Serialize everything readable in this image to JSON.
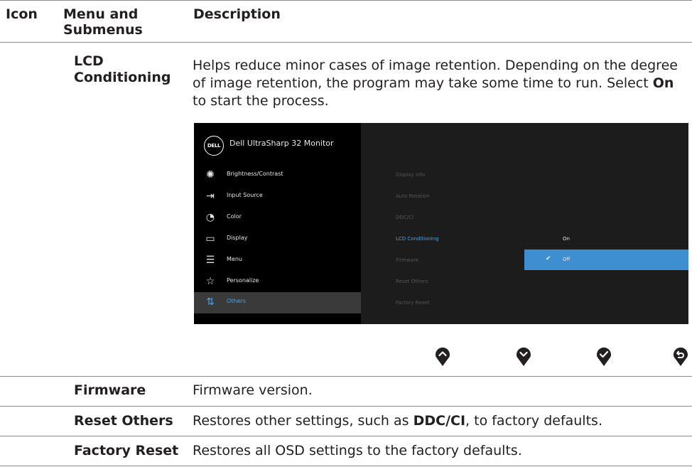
{
  "header": {
    "icon": "Icon",
    "menu": "Menu and Submenus",
    "description": "Description"
  },
  "rows": {
    "lcd": {
      "term": "LCD Conditioning",
      "desc_before": "Helps reduce minor cases of image retention. Depending on the degree of image retention, the program may take some time to run. Select ",
      "desc_bold": "On",
      "desc_after": " to start the process."
    },
    "firmware": {
      "term": "Firmware",
      "desc": "Firmware version."
    },
    "reset_others": {
      "term": "Reset Others",
      "desc_before": "Restores other settings, such as ",
      "desc_bold": "DDC/CI",
      "desc_after": ", to factory defaults."
    },
    "factory_reset": {
      "term": "Factory Reset",
      "desc": "Restores all OSD settings to the factory defaults."
    }
  },
  "osd": {
    "logo": "DELL",
    "title": "Dell UltraSharp 32 Monitor",
    "menu": [
      {
        "label": "Brightness/Contrast",
        "icon": "brightness-icon"
      },
      {
        "label": "Input Source",
        "icon": "input-source-icon"
      },
      {
        "label": "Color",
        "icon": "color-palette-icon"
      },
      {
        "label": "Display",
        "icon": "display-icon"
      },
      {
        "label": "Menu",
        "icon": "menu-icon"
      },
      {
        "label": "Personalize",
        "icon": "star-icon"
      },
      {
        "label": "Others",
        "icon": "others-icon"
      }
    ],
    "active_menu": "Others",
    "submenu": [
      "Display Info",
      "Auto Rotation",
      "DDC/CI",
      "LCD Conditioning",
      "Firmware",
      "Reset Others",
      "Factory Reset"
    ],
    "highlighted_submenu": "LCD Conditioning",
    "options": [
      "On",
      "Off"
    ],
    "selected_option": "Off",
    "colors": {
      "accent": "#4aa3df",
      "selection_bar": "#3d8fd2",
      "panel": "#1c1c1c",
      "menu_bg": "#000000"
    }
  },
  "joystick_buttons": [
    "up-button-icon",
    "down-button-icon",
    "confirm-button-icon",
    "back-button-icon"
  ]
}
